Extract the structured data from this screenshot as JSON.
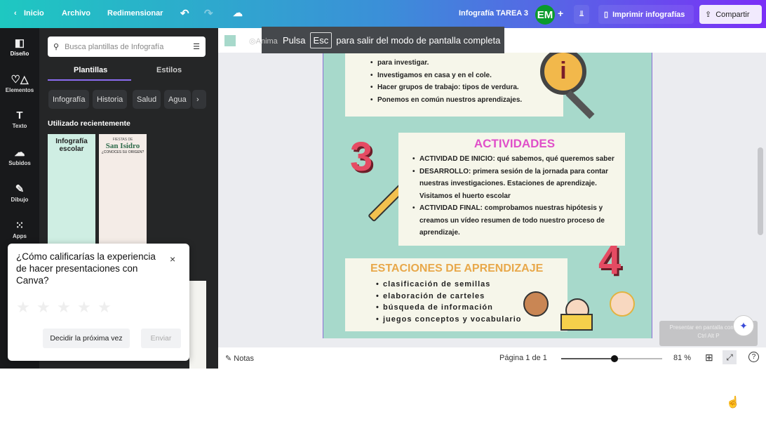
{
  "topbar": {
    "home": "Inicio",
    "file": "Archivo",
    "resize": "Redimensionar",
    "doc_title": "Infografía TAREA 3",
    "avatar": "EM",
    "print": "Imprimir infografías",
    "share": "Compartir"
  },
  "rail": [
    {
      "label": "Diseño",
      "icon": "layout-icon"
    },
    {
      "label": "Elementos",
      "icon": "shapes-icon"
    },
    {
      "label": "Texto",
      "icon": "text-icon"
    },
    {
      "label": "Subidos",
      "icon": "cloud-upload-icon"
    },
    {
      "label": "Dibujo",
      "icon": "draw-icon"
    },
    {
      "label": "Apps",
      "icon": "apps-grid-icon"
    }
  ],
  "panel": {
    "search_placeholder": "Busca plantillas de Infografía",
    "tabs": [
      "Plantillas",
      "Estilos"
    ],
    "chips": [
      "Infografía",
      "Historia",
      "Salud",
      "Agua",
      "In"
    ],
    "recent_title": "Utilizado recientemente",
    "thumbs": [
      {
        "title": "Infografía escolar"
      },
      {
        "kicker": "FIESTAS DE",
        "title": "San Isidro",
        "sub": "¿CONOCES SU ORIGEN?"
      }
    ]
  },
  "toolbar": {
    "animate": "Anima"
  },
  "overlay": {
    "pre": "Pulsa",
    "key": "Esc",
    "post": "para salir del modo de pantalla completa"
  },
  "infographic": {
    "section2_items": [
      "para investigar.",
      "Investigamos en casa y en el cole.",
      "Hacer grupos de trabajo: tipos de verdura.",
      "Ponemos en común nuestros aprendizajes."
    ],
    "section3": {
      "number": "3",
      "title": "ACTIVIDADES",
      "items": [
        "ACTIVIDAD DE INICIO: qué sabemos, qué queremos saber",
        "DESARROLLO: primera sesión de la jornada para contar nuestras investigaciones. Estaciones de aprendizaje. Visitamos el huerto escolar",
        "ACTIVIDAD FINAL: comprobamos nuestras hipótesis y creamos un vídeo resumen de todo nuestro proceso de aprendizaje."
      ]
    },
    "section4": {
      "number": "4",
      "title": "ESTACIONES DE APRENDIZAJE",
      "items": [
        "clasificación de semillas",
        "elaboración de carteles",
        "búsqueda de información",
        "juegos conceptos y vocabulario"
      ]
    },
    "colors": {
      "background": "#a7d9cb",
      "card": "#f6f6ea",
      "activities_title": "#e04fc9",
      "stations_title": "#e8a84a",
      "numbers": "#e54b63"
    }
  },
  "tooltip": {
    "label": "Presentar en pantalla completa",
    "keys": [
      "Ctrl",
      "Alt",
      "P"
    ]
  },
  "bottom": {
    "notes": "Notas",
    "page": "Página 1 de 1",
    "zoom": "81 %",
    "zoom_value": 81
  },
  "dialog": {
    "question": "¿Cómo calificarías la experiencia de hacer presentaciones con Canva?",
    "rating": 0,
    "max_rating": 5,
    "later": "Decidir la próxima vez",
    "send": "Enviar"
  }
}
